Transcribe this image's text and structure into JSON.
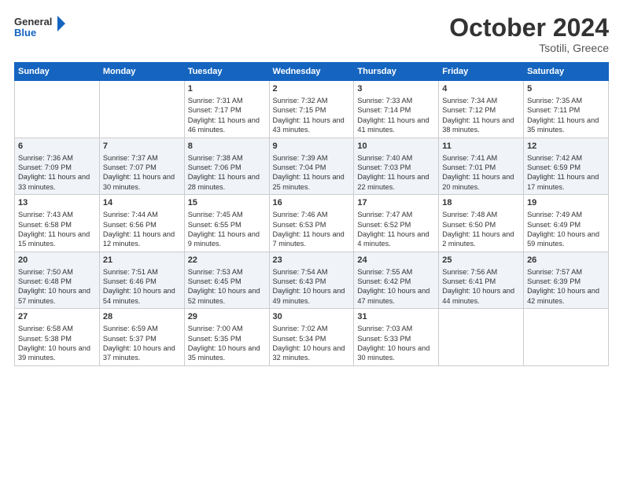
{
  "header": {
    "logo_line1": "General",
    "logo_line2": "Blue",
    "month": "October 2024",
    "location": "Tsotili, Greece"
  },
  "weekdays": [
    "Sunday",
    "Monday",
    "Tuesday",
    "Wednesday",
    "Thursday",
    "Friday",
    "Saturday"
  ],
  "weeks": [
    [
      {
        "day": "",
        "info": ""
      },
      {
        "day": "",
        "info": ""
      },
      {
        "day": "1",
        "info": "Sunrise: 7:31 AM\nSunset: 7:17 PM\nDaylight: 11 hours and 46 minutes."
      },
      {
        "day": "2",
        "info": "Sunrise: 7:32 AM\nSunset: 7:15 PM\nDaylight: 11 hours and 43 minutes."
      },
      {
        "day": "3",
        "info": "Sunrise: 7:33 AM\nSunset: 7:14 PM\nDaylight: 11 hours and 41 minutes."
      },
      {
        "day": "4",
        "info": "Sunrise: 7:34 AM\nSunset: 7:12 PM\nDaylight: 11 hours and 38 minutes."
      },
      {
        "day": "5",
        "info": "Sunrise: 7:35 AM\nSunset: 7:11 PM\nDaylight: 11 hours and 35 minutes."
      }
    ],
    [
      {
        "day": "6",
        "info": "Sunrise: 7:36 AM\nSunset: 7:09 PM\nDaylight: 11 hours and 33 minutes."
      },
      {
        "day": "7",
        "info": "Sunrise: 7:37 AM\nSunset: 7:07 PM\nDaylight: 11 hours and 30 minutes."
      },
      {
        "day": "8",
        "info": "Sunrise: 7:38 AM\nSunset: 7:06 PM\nDaylight: 11 hours and 28 minutes."
      },
      {
        "day": "9",
        "info": "Sunrise: 7:39 AM\nSunset: 7:04 PM\nDaylight: 11 hours and 25 minutes."
      },
      {
        "day": "10",
        "info": "Sunrise: 7:40 AM\nSunset: 7:03 PM\nDaylight: 11 hours and 22 minutes."
      },
      {
        "day": "11",
        "info": "Sunrise: 7:41 AM\nSunset: 7:01 PM\nDaylight: 11 hours and 20 minutes."
      },
      {
        "day": "12",
        "info": "Sunrise: 7:42 AM\nSunset: 6:59 PM\nDaylight: 11 hours and 17 minutes."
      }
    ],
    [
      {
        "day": "13",
        "info": "Sunrise: 7:43 AM\nSunset: 6:58 PM\nDaylight: 11 hours and 15 minutes."
      },
      {
        "day": "14",
        "info": "Sunrise: 7:44 AM\nSunset: 6:56 PM\nDaylight: 11 hours and 12 minutes."
      },
      {
        "day": "15",
        "info": "Sunrise: 7:45 AM\nSunset: 6:55 PM\nDaylight: 11 hours and 9 minutes."
      },
      {
        "day": "16",
        "info": "Sunrise: 7:46 AM\nSunset: 6:53 PM\nDaylight: 11 hours and 7 minutes."
      },
      {
        "day": "17",
        "info": "Sunrise: 7:47 AM\nSunset: 6:52 PM\nDaylight: 11 hours and 4 minutes."
      },
      {
        "day": "18",
        "info": "Sunrise: 7:48 AM\nSunset: 6:50 PM\nDaylight: 11 hours and 2 minutes."
      },
      {
        "day": "19",
        "info": "Sunrise: 7:49 AM\nSunset: 6:49 PM\nDaylight: 10 hours and 59 minutes."
      }
    ],
    [
      {
        "day": "20",
        "info": "Sunrise: 7:50 AM\nSunset: 6:48 PM\nDaylight: 10 hours and 57 minutes."
      },
      {
        "day": "21",
        "info": "Sunrise: 7:51 AM\nSunset: 6:46 PM\nDaylight: 10 hours and 54 minutes."
      },
      {
        "day": "22",
        "info": "Sunrise: 7:53 AM\nSunset: 6:45 PM\nDaylight: 10 hours and 52 minutes."
      },
      {
        "day": "23",
        "info": "Sunrise: 7:54 AM\nSunset: 6:43 PM\nDaylight: 10 hours and 49 minutes."
      },
      {
        "day": "24",
        "info": "Sunrise: 7:55 AM\nSunset: 6:42 PM\nDaylight: 10 hours and 47 minutes."
      },
      {
        "day": "25",
        "info": "Sunrise: 7:56 AM\nSunset: 6:41 PM\nDaylight: 10 hours and 44 minutes."
      },
      {
        "day": "26",
        "info": "Sunrise: 7:57 AM\nSunset: 6:39 PM\nDaylight: 10 hours and 42 minutes."
      }
    ],
    [
      {
        "day": "27",
        "info": "Sunrise: 6:58 AM\nSunset: 5:38 PM\nDaylight: 10 hours and 39 minutes."
      },
      {
        "day": "28",
        "info": "Sunrise: 6:59 AM\nSunset: 5:37 PM\nDaylight: 10 hours and 37 minutes."
      },
      {
        "day": "29",
        "info": "Sunrise: 7:00 AM\nSunset: 5:35 PM\nDaylight: 10 hours and 35 minutes."
      },
      {
        "day": "30",
        "info": "Sunrise: 7:02 AM\nSunset: 5:34 PM\nDaylight: 10 hours and 32 minutes."
      },
      {
        "day": "31",
        "info": "Sunrise: 7:03 AM\nSunset: 5:33 PM\nDaylight: 10 hours and 30 minutes."
      },
      {
        "day": "",
        "info": ""
      },
      {
        "day": "",
        "info": ""
      }
    ]
  ]
}
